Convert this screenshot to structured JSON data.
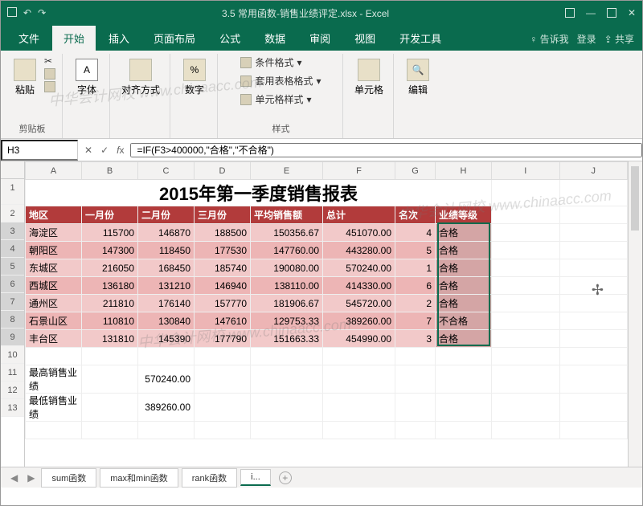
{
  "title": "3.5 常用函数-销售业绩评定.xlsx - Excel",
  "tabs": {
    "file": "文件",
    "home": "开始",
    "insert": "插入",
    "pagelayout": "页面布局",
    "formulas": "公式",
    "data": "数据",
    "review": "审阅",
    "view": "视图",
    "developer": "开发工具",
    "tell": "告诉我",
    "signin": "登录",
    "share": "共享"
  },
  "ribbon": {
    "paste": "粘贴",
    "clipboard": "剪贴板",
    "font": "字体",
    "align": "对齐方式",
    "number": "数字",
    "cond": "条件格式",
    "tablefmt": "套用表格格式",
    "cellstyle": "单元格样式",
    "styles": "样式",
    "cells": "单元格",
    "editing": "编辑"
  },
  "namebox": "H3",
  "formula": "=IF(F3>400000,\"合格\",\"不合格\")",
  "cols": [
    "A",
    "B",
    "C",
    "D",
    "E",
    "F",
    "G",
    "H",
    "I",
    "J"
  ],
  "rows": [
    "1",
    "2",
    "3",
    "4",
    "5",
    "6",
    "7",
    "8",
    "9",
    "10",
    "11",
    "12",
    "13"
  ],
  "sheet_title": "2015年第一季度销售报表",
  "headers": [
    "地区",
    "一月份",
    "二月份",
    "三月份",
    "平均销售额",
    "总计",
    "名次",
    "业绩等级"
  ],
  "data": [
    {
      "r": "海淀区",
      "m1": "115700",
      "m2": "146870",
      "m3": "188500",
      "avg": "150356.67",
      "sum": "451070.00",
      "rank": "4",
      "grade": "合格"
    },
    {
      "r": "朝阳区",
      "m1": "147300",
      "m2": "118450",
      "m3": "177530",
      "avg": "147760.00",
      "sum": "443280.00",
      "rank": "5",
      "grade": "合格"
    },
    {
      "r": "东城区",
      "m1": "216050",
      "m2": "168450",
      "m3": "185740",
      "avg": "190080.00",
      "sum": "570240.00",
      "rank": "1",
      "grade": "合格"
    },
    {
      "r": "西城区",
      "m1": "136180",
      "m2": "131210",
      "m3": "146940",
      "avg": "138110.00",
      "sum": "414330.00",
      "rank": "6",
      "grade": "合格"
    },
    {
      "r": "通州区",
      "m1": "211810",
      "m2": "176140",
      "m3": "157770",
      "avg": "181906.67",
      "sum": "545720.00",
      "rank": "2",
      "grade": "合格"
    },
    {
      "r": "石景山区",
      "m1": "110810",
      "m2": "130840",
      "m3": "147610",
      "avg": "129753.33",
      "sum": "389260.00",
      "rank": "7",
      "grade": "不合格"
    },
    {
      "r": "丰台区",
      "m1": "131810",
      "m2": "145390",
      "m3": "177790",
      "avg": "151663.33",
      "sum": "454990.00",
      "rank": "3",
      "grade": "合格"
    }
  ],
  "summary": {
    "max_l": "最高销售业绩",
    "max_v": "570240.00",
    "min_l": "最低销售业绩",
    "min_v": "389260.00"
  },
  "sheets": [
    "sum函数",
    "max和min函数",
    "rank函数",
    "i..."
  ],
  "watermark": "中华会计网校 www.chinaacc.com"
}
